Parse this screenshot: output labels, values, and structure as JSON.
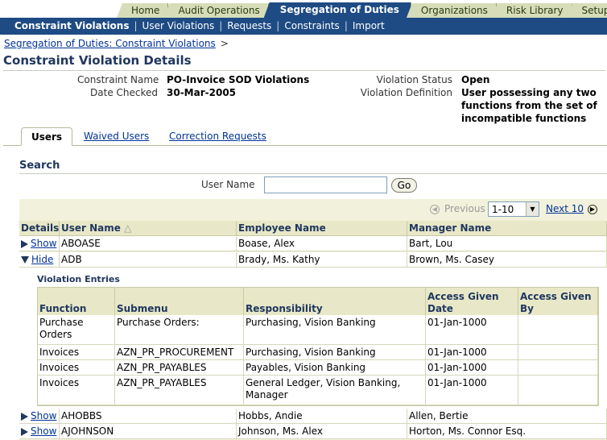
{
  "top_tabs": [
    "Home",
    "Audit Operations",
    "Segregation of Duties",
    "Organizations",
    "Risk Library",
    "Setup"
  ],
  "nav": [
    "Constraint Violations",
    "User Violations",
    "Requests",
    "Constraints",
    "Import"
  ],
  "breadcrumb": {
    "link": "Segregation of Duties: Constraint Violations",
    "arrow": ">"
  },
  "page_title": "Constraint Violation Details",
  "details": {
    "constraint_name_label": "Constraint Name",
    "constraint_name": "PO-Invoice SOD Violations",
    "date_checked_label": "Date Checked",
    "date_checked": "30-Mar-2005",
    "violation_status_label": "Violation Status",
    "violation_status": "Open",
    "violation_definition_label": "Violation Definition",
    "violation_definition_lines": [
      "User possessing any two",
      "functions from the set of",
      "incompatible functions"
    ]
  },
  "subtabs": [
    "Users",
    "Waived Users",
    "Correction Requests"
  ],
  "search": {
    "heading": "Search",
    "label": "User Name",
    "value": "",
    "go": "Go"
  },
  "pager": {
    "previous": "Previous",
    "range": "1-10",
    "next": "Next 10"
  },
  "columns": [
    "Details",
    "User Name",
    "Employee Name",
    "Manager Name"
  ],
  "rows": [
    {
      "toggle": "Show",
      "user": "ABOASE",
      "employee": "Boase, Alex",
      "manager": "Bart, Lou"
    },
    {
      "toggle": "Hide",
      "user": "ADB",
      "employee": "Brady, Ms. Kathy",
      "manager": "Brown, Ms. Casey"
    },
    {
      "toggle": "Show",
      "user": "AHOBBS",
      "employee": "Hobbs, Andie",
      "manager": "Allen, Bertie"
    },
    {
      "toggle": "Show",
      "user": "AJOHNSON",
      "employee": "Johnson, Ms. Alex",
      "manager": "Horton, Ms. Connor Esq."
    }
  ],
  "violation_entries": {
    "heading": "Violation Entries",
    "columns": [
      "Function",
      "Submenu",
      "Responsibility",
      "Access Given Date",
      "Access Given By"
    ],
    "rows": [
      {
        "function": "Purchase Orders",
        "submenu": "Purchase Orders:",
        "responsibility": "Purchasing, Vision Banking",
        "date": "01-Jan-1000",
        "by": ""
      },
      {
        "function": "Invoices",
        "submenu": "AZN_PR_PROCUREMENT",
        "responsibility": "Purchasing, Vision Banking",
        "date": "01-Jan-1000",
        "by": ""
      },
      {
        "function": "Invoices",
        "submenu": "AZN_PR_PAYABLES",
        "responsibility": "Payables, Vision Banking",
        "date": "01-Jan-1000",
        "by": ""
      },
      {
        "function": "Invoices",
        "submenu": "AZN_PR_PAYABLES",
        "responsibility": "General Ledger, Vision Banking, Manager",
        "date": "01-Jan-1000",
        "by": ""
      }
    ]
  },
  "colors": {
    "brand_blue": "#1e4b84",
    "tab_inactive": "#d6ddb8",
    "table_bg": "#f2f2dc",
    "header_bg": "#e8e8c8",
    "link": "#003399"
  },
  "icons": [
    "previous-icon",
    "next-icon",
    "dropdown-arrow-icon",
    "expand-triangle-icon",
    "collapse-triangle-icon",
    "sort-ascending-icon"
  ]
}
